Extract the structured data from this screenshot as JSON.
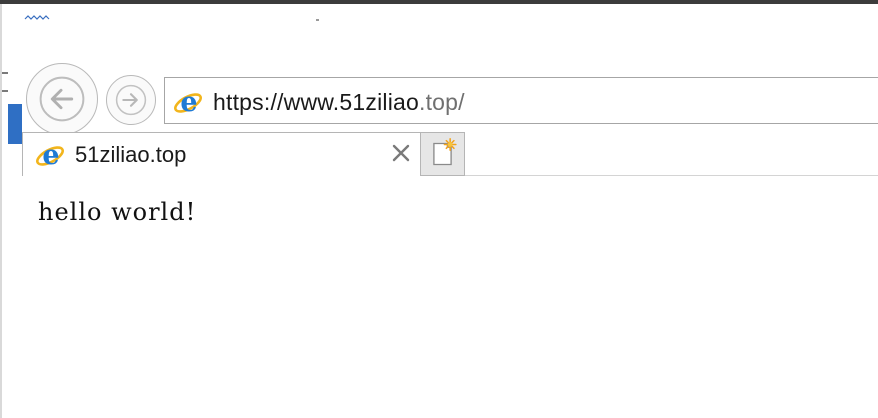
{
  "browser": {
    "address_bar": {
      "url_protocol": "https://",
      "url_host": "www.51ziliao",
      "url_tail": ".top/"
    },
    "tabs": [
      {
        "title": "51ziliao.top",
        "favicon": "ie-logo-icon",
        "active": true
      }
    ],
    "icons": {
      "back": "back-arrow-icon",
      "forward": "forward-arrow-icon",
      "close_tab": "close-icon",
      "new_tab": "new-tab-icon"
    }
  },
  "page": {
    "body_text": "hello world!"
  },
  "colors": {
    "ie_logo_blue": "#1f7ad4",
    "ie_ring_gold": "#f2b51c",
    "accent_blue_tab": "#2f6fc4"
  }
}
